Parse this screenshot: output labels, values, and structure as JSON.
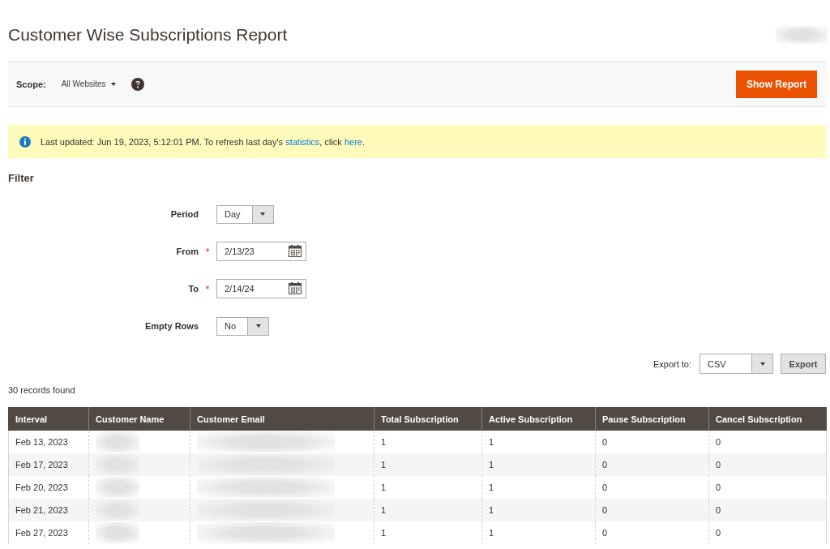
{
  "page_title": "Customer Wise Subscriptions Report",
  "account": {
    "redacted": true
  },
  "scope_bar": {
    "label": "Scope:",
    "value": "All Websites",
    "button": "Show Report"
  },
  "message": {
    "parts": [
      {
        "kind": "text",
        "text": "Last updated: Jun 19, 2023, 5:12:01 PM. To refresh last day's "
      },
      {
        "kind": "link",
        "text": "statistics"
      },
      {
        "kind": "text",
        "text": ", click "
      },
      {
        "kind": "link",
        "text": "here"
      },
      {
        "kind": "text",
        "text": "."
      }
    ]
  },
  "filter": {
    "title": "Filter",
    "fields": [
      {
        "kind": "select",
        "label": "Period",
        "value": "Day"
      },
      {
        "kind": "date",
        "label": "From",
        "required_mark": "*",
        "value": "2/13/23"
      },
      {
        "kind": "date",
        "label": "To",
        "required_mark": "*",
        "value": "2/14/24"
      },
      {
        "kind": "select",
        "label": "Empty Rows",
        "value": "No"
      }
    ]
  },
  "export": {
    "label": "Export to:",
    "format": "CSV",
    "button": "Export"
  },
  "records_found": "30 records found",
  "table": {
    "columns": [
      "Interval",
      "Customer Name",
      "Customer Email",
      "Total Subscription",
      "Active Subscription",
      "Pause Subscription",
      "Cancel Subscription"
    ],
    "rows": [
      {
        "cells": [
          {
            "text": "Feb 13, 2023"
          },
          {
            "redacted": true
          },
          {
            "redacted": true
          },
          {
            "text": "1"
          },
          {
            "text": "1"
          },
          {
            "text": "0"
          },
          {
            "text": "0"
          }
        ]
      },
      {
        "cells": [
          {
            "text": "Feb 17, 2023"
          },
          {
            "redacted": true
          },
          {
            "redacted": true
          },
          {
            "text": "1"
          },
          {
            "text": "1"
          },
          {
            "text": "0"
          },
          {
            "text": "0"
          }
        ]
      },
      {
        "cells": [
          {
            "text": "Feb 20, 2023"
          },
          {
            "redacted": true
          },
          {
            "redacted": true
          },
          {
            "text": "1"
          },
          {
            "text": "1"
          },
          {
            "text": "0"
          },
          {
            "text": "0"
          }
        ]
      },
      {
        "cells": [
          {
            "text": "Feb 21, 2023"
          },
          {
            "redacted": true
          },
          {
            "redacted": true
          },
          {
            "text": "1"
          },
          {
            "text": "1"
          },
          {
            "text": "0"
          },
          {
            "text": "0"
          }
        ]
      },
      {
        "cells": [
          {
            "text": "Feb 27, 2023"
          },
          {
            "redacted": true
          },
          {
            "redacted": true
          },
          {
            "text": "1"
          },
          {
            "text": "1"
          },
          {
            "text": "0"
          },
          {
            "text": "0"
          }
        ]
      }
    ]
  }
}
